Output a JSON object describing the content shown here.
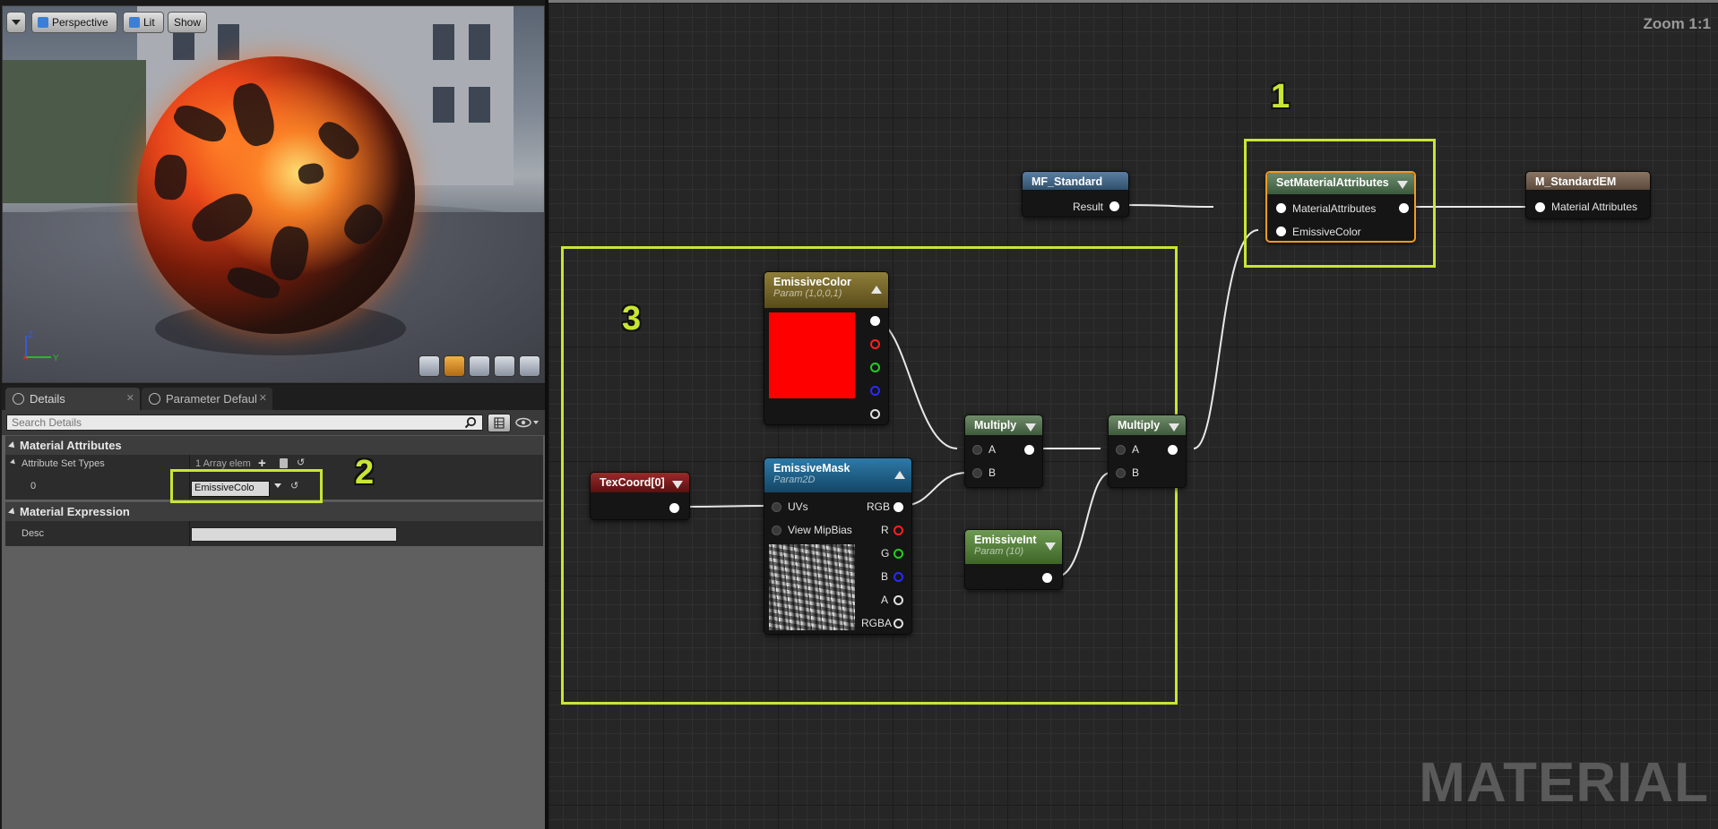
{
  "viewport": {
    "perspective_label": "Perspective",
    "lit_label": "Lit",
    "show_label": "Show",
    "axis_z": "Z",
    "axis_y": "Y"
  },
  "details": {
    "tab_details": "Details",
    "tab_params": "Parameter Defaults",
    "search_placeholder": "Search Details",
    "cat_material_attributes": "Material Attributes",
    "attr_set_types_label": "Attribute Set Types",
    "array_elems": "1 Array elem",
    "index0": "0",
    "enum_value": "EmissiveColo",
    "cat_material_expression": "Material Expression",
    "desc_label": "Desc"
  },
  "graph": {
    "zoom": "Zoom 1:1",
    "watermark": "MATERIAL",
    "callouts": [
      "1",
      "2",
      "3"
    ],
    "nodes": {
      "mf_standard": {
        "title": "MF_Standard",
        "pin_result": "Result"
      },
      "set_attrs": {
        "title": "SetMaterialAttributes",
        "pin_material_attributes": "MaterialAttributes",
        "pin_emissive": "EmissiveColor"
      },
      "m_standard": {
        "title": "M_StandardEM",
        "pin_material_attributes": "Material Attributes"
      },
      "emissive_color": {
        "title": "EmissiveColor",
        "sub": "Param (1,0,0,1)",
        "swatch": "#ff0000"
      },
      "texcoord": {
        "title": "TexCoord[0]"
      },
      "emissive_mask": {
        "title": "EmissiveMask",
        "sub": "Param2D",
        "pin_uvs": "UVs",
        "pin_mip": "View MipBias",
        "pin_rgb": "RGB",
        "pin_r": "R",
        "pin_g": "G",
        "pin_b": "B",
        "pin_a": "A",
        "pin_rgba": "RGBA"
      },
      "multiply1": {
        "title": "Multiply",
        "pin_a": "A",
        "pin_b": "B"
      },
      "multiply2": {
        "title": "Multiply",
        "pin_a": "A",
        "pin_b": "B"
      },
      "emissive_int": {
        "title": "EmissiveInt",
        "sub": "Param (10)"
      }
    }
  },
  "colors": {
    "callout": "#c8e632",
    "header_blue": "#3b5a78",
    "header_green": "#4a6a45",
    "header_brown": "#6f5a48",
    "header_gold": "#7a6a2a",
    "header_red": "#7a1a1a",
    "header_cyan": "#1f5f85",
    "header_lightgreen": "#56803e",
    "selected_outline": "#f39a1e"
  }
}
